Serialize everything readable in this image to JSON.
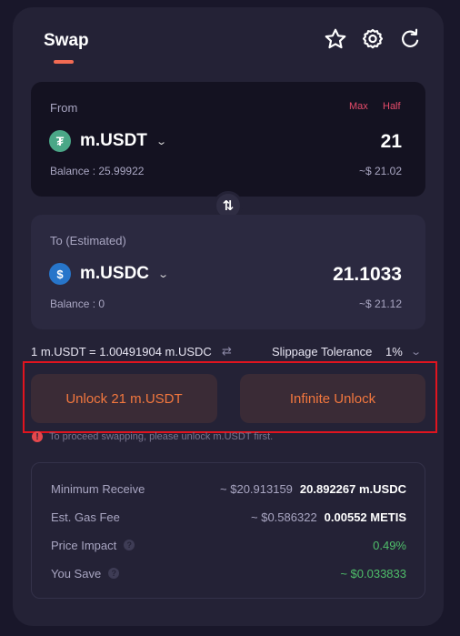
{
  "header": {
    "tab_label": "Swap",
    "icons": [
      "star-icon",
      "gear-icon",
      "refresh-icon"
    ]
  },
  "from": {
    "label": "From",
    "max_label": "Max",
    "half_label": "Half",
    "token": "m.USDT",
    "token_glyph": "₮",
    "amount": "21",
    "balance": "Balance : 25.99922",
    "usd_value": "~$ 21.02"
  },
  "flip_icon": "⇅",
  "to": {
    "label": "To (Estimated)",
    "token": "m.USDC",
    "token_glyph": "$",
    "amount": "21.1033",
    "balance": "Balance : 0",
    "usd_value": "~$ 21.12"
  },
  "rate": {
    "text": "1 m.USDT = 1.00491904 m.USDC",
    "swap_icon": "⇄"
  },
  "slippage": {
    "label": "Slippage Tolerance",
    "value": "1%"
  },
  "actions": {
    "unlock_label": "Unlock 21 m.USDT",
    "infinite_label": "Infinite Unlock"
  },
  "warning": {
    "icon": "!",
    "text": "To proceed swapping, please unlock m.USDT first."
  },
  "details": {
    "min_receive": {
      "label": "Minimum Receive",
      "approx": "~ $20.913159",
      "value": "20.892267 m.USDC"
    },
    "gas_fee": {
      "label": "Est. Gas Fee",
      "approx": "~ $0.586322",
      "value": "0.00552 METIS"
    },
    "price_impact": {
      "label": "Price Impact",
      "value": "0.49%"
    },
    "you_save": {
      "label": "You Save",
      "value": "~ $0.033833"
    }
  },
  "colors": {
    "accent": "#f2773e",
    "brand_underline": "#f26b53",
    "max_half": "#e54b6a",
    "green": "#4fbf6a",
    "highlight": "#e0141f"
  }
}
